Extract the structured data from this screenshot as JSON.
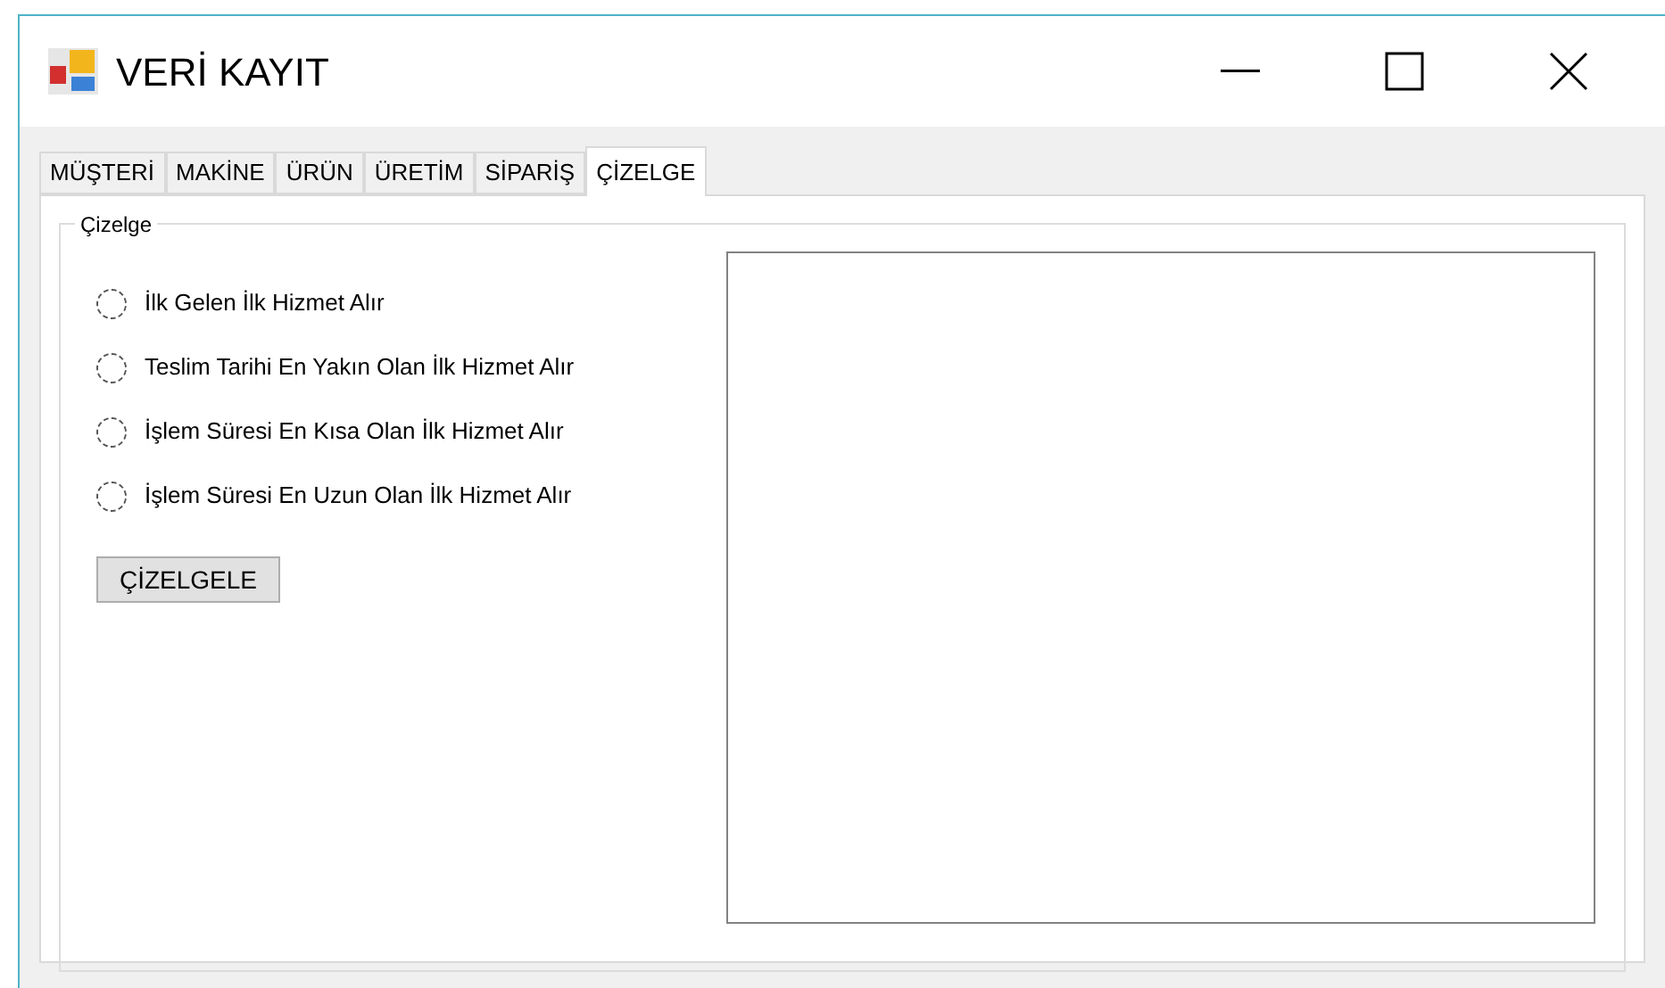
{
  "window": {
    "title": "VERİ KAYIT"
  },
  "tabs": [
    {
      "label": "MÜŞTERİ",
      "selected": false
    },
    {
      "label": "MAKİNE",
      "selected": false
    },
    {
      "label": "ÜRÜN",
      "selected": false
    },
    {
      "label": "ÜRETİM",
      "selected": false
    },
    {
      "label": "SİPARİŞ",
      "selected": false
    },
    {
      "label": "ÇİZELGE",
      "selected": true
    }
  ],
  "group": {
    "title": "Çizelge"
  },
  "options": [
    {
      "label": "İlk Gelen İlk Hizmet Alır",
      "selected": false
    },
    {
      "label": "Teslim Tarihi En Yakın Olan İlk Hizmet Alır",
      "selected": false
    },
    {
      "label": "İşlem Süresi En Kısa Olan İlk Hizmet Alır",
      "selected": false
    },
    {
      "label": "İşlem Süresi En Uzun Olan İlk Hizmet Alır",
      "selected": false
    }
  ],
  "button": {
    "label": "ÇİZELGELE"
  }
}
